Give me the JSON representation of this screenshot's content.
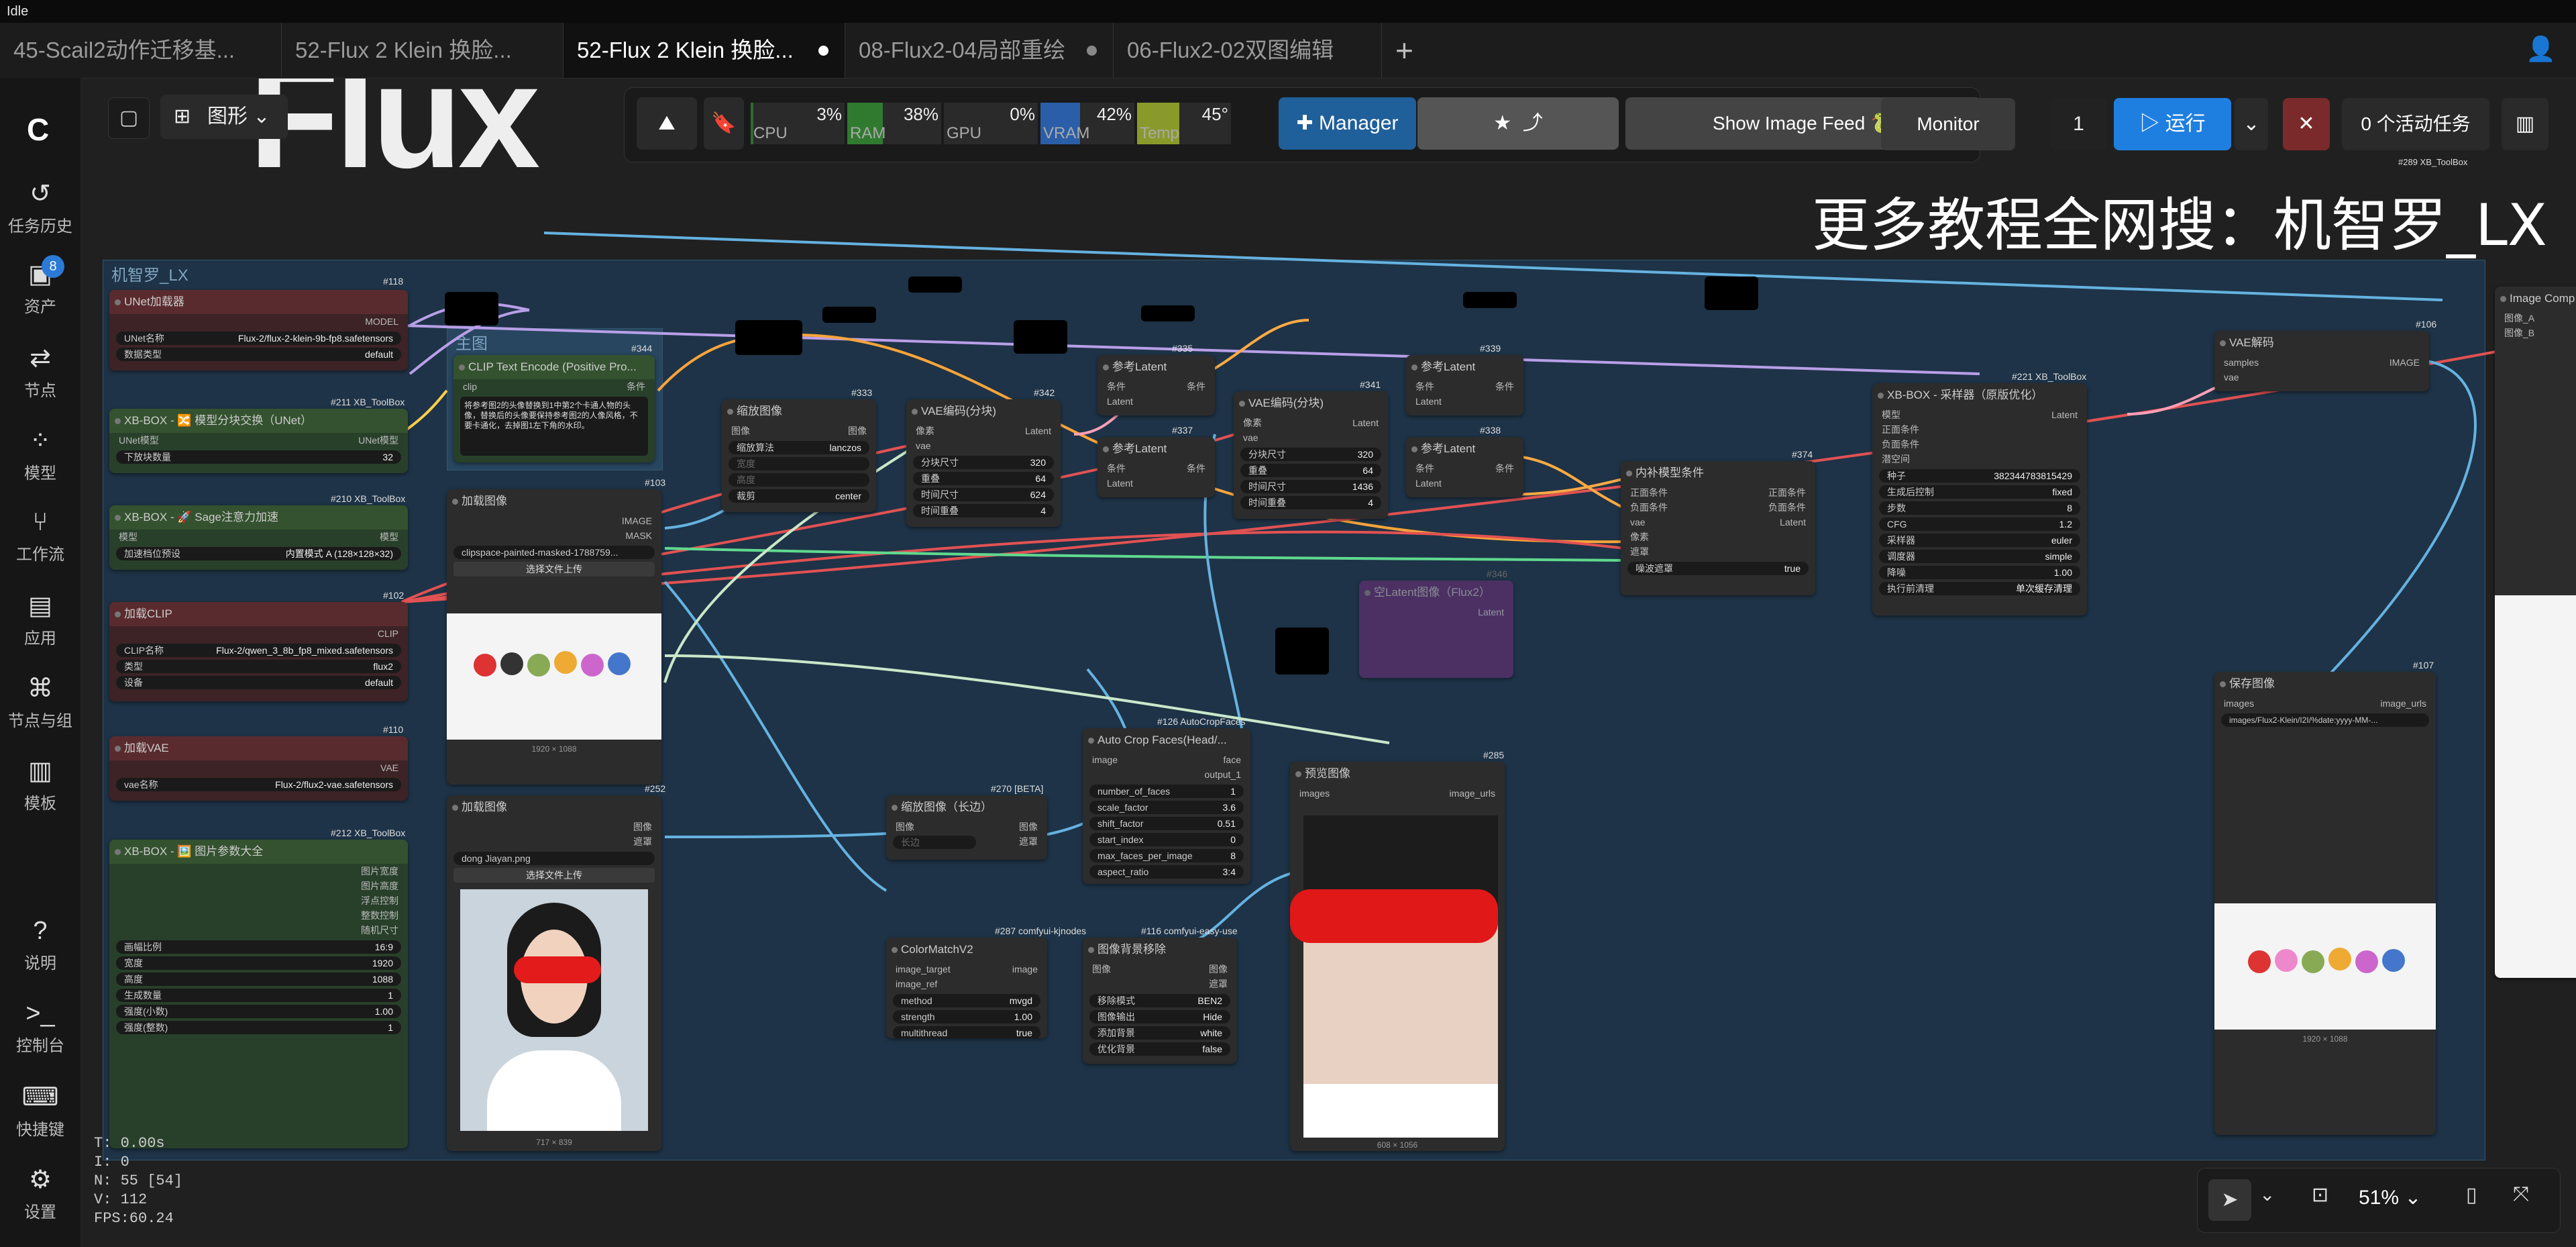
{
  "titlebar": {
    "title": "Idle"
  },
  "tabs": [
    {
      "label": "45-Scail2动作迁移基..."
    },
    {
      "label": "52-Flux 2 Klein 换脸..."
    },
    {
      "label": "52-Flux 2 Klein 换脸..."
    },
    {
      "label": "08-Flux2-04局部重绘"
    },
    {
      "label": "06-Flux2-02双图编辑"
    }
  ],
  "sidebar": {
    "badge_count": "8",
    "items": [
      {
        "label": "任务历史"
      },
      {
        "label": "资产"
      },
      {
        "label": "节点"
      },
      {
        "label": "模型"
      },
      {
        "label": "工作流"
      },
      {
        "label": "应用"
      },
      {
        "label": "节点与组"
      },
      {
        "label": "模板"
      },
      {
        "label": "说明"
      },
      {
        "label": "控制台"
      },
      {
        "label": "快捷键"
      },
      {
        "label": "设置"
      }
    ]
  },
  "canvas_toolbar": {
    "view_mode": "图形"
  },
  "banner": {
    "text": "更多教程全网搜：机智罗_LX",
    "logo_text": "Flux"
  },
  "monitors": [
    {
      "label": "CPU",
      "value": "3%",
      "level": 0.03,
      "color": "#2f6b2f"
    },
    {
      "label": "RAM",
      "value": "38%",
      "level": 0.38,
      "color": "#2f7a2f"
    },
    {
      "label": "GPU",
      "value": "0%",
      "level": 0.0,
      "color": "#2f6b2f"
    },
    {
      "label": "VRAM",
      "value": "42%",
      "level": 0.42,
      "color": "#2b5ea8"
    },
    {
      "label": "Temp",
      "value": "45°",
      "level": 0.45,
      "color": "#8a9a2a"
    }
  ],
  "toolbar": {
    "manager": "Manager",
    "show_image_feed": "Show Image Feed 🐍",
    "monitor": "Monitor",
    "batch_count": "1",
    "run": "运行",
    "active_tasks": "0 个活动任务",
    "toolbox_tag": "#289 XB_ToolBox"
  },
  "group": {
    "title": "机智罗_LX",
    "inner_title": "主图"
  },
  "nodes": {
    "unet": {
      "id": "#118",
      "title": "UNet加载器",
      "out": "MODEL",
      "w1k": "UNet名称",
      "w1v": "Flux-2/flux-2-klein-9b-fp8.safetensors",
      "w2k": "数据类型",
      "w2v": "default"
    },
    "swap": {
      "id": "#211 XB_ToolBox",
      "title": "XB-BOX - 🔀 模型分块交换（UNet）",
      "in": "UNet模型",
      "out": "UNet模型",
      "w1k": "下放块数量",
      "w1v": "32"
    },
    "sage": {
      "id": "#210 XB_ToolBox",
      "title": "XB-BOX - 🚀 Sage注意力加速",
      "in": "模型",
      "out": "模型",
      "w1k": "加速档位预设",
      "w1v": "内置模式 A (128×128×32)"
    },
    "clip": {
      "id": "#102",
      "title": "加载CLIP",
      "out": "CLIP",
      "w1k": "CLIP名称",
      "w1v": "Flux-2/qwen_3_8b_fp8_mixed.safetensors",
      "w2k": "类型",
      "w2v": "flux2",
      "w3k": "设备",
      "w3v": "default"
    },
    "vae": {
      "id": "#110",
      "title": "加载VAE",
      "out": "VAE",
      "w1k": "vae名称",
      "w1v": "Flux-2/flux2-vae.safetensors"
    },
    "params": {
      "id": "#212 XB_ToolBox",
      "title": "XB-BOX - 🖼️ 图片参数大全",
      "outs": [
        "图片宽度",
        "图片高度",
        "浮点控制",
        "整数控制",
        "随机尺寸"
      ],
      "rows": [
        [
          "画幅比例",
          "16:9"
        ],
        [
          "宽度",
          "1920"
        ],
        [
          "高度",
          "1088"
        ],
        [
          "生成数量",
          "1"
        ],
        [
          "强度(小数)",
          "1.00"
        ],
        [
          "强度(整数)",
          "1"
        ]
      ]
    },
    "clip_text": {
      "id": "#344",
      "title": "CLIP Text Encode (Positive Pro...",
      "in": "clip",
      "out": "条件",
      "text": "将参考图2的头像替换到1中第2个卡通人物的头像，替换后的头像要保持参考图2的人像风格，不要卡通化，去掉图1左下角的水印。"
    },
    "load1": {
      "id": "#103",
      "title": "加载图像",
      "outs": [
        "IMAGE",
        "MASK"
      ],
      "file": "clipspace-painted-masked-1788759...",
      "upload": "选择文件上传",
      "caption": "1920 × 1088"
    },
    "load2": {
      "id": "#252",
      "title": "加载图像",
      "outs": [
        "图像",
        "遮罩"
      ],
      "file": "dong Jiayan.png",
      "upload": "选择文件上传",
      "caption": "717 × 839"
    },
    "scale": {
      "id": "#333",
      "title": "缩放图像",
      "in": "图像",
      "out": "图像",
      "rows": [
        [
          "缩放算法",
          "lanczos"
        ],
        [
          "宽度",
          ""
        ],
        [
          "高度",
          ""
        ],
        [
          "裁剪",
          "center"
        ]
      ]
    },
    "vaeenc1": {
      "id": "#342",
      "title": "VAE编码(分块)",
      "ins": [
        "像素",
        "vae"
      ],
      "out": "Latent",
      "rows": [
        [
          "分块尺寸",
          "320"
        ],
        [
          "重叠",
          "64"
        ],
        [
          "时间尺寸",
          "624"
        ],
        [
          "时间重叠",
          "4"
        ]
      ]
    },
    "ref1": {
      "id": "#335",
      "title": "参考Latent",
      "ins": [
        "条件",
        "Latent"
      ],
      "out": "条件"
    },
    "ref2": {
      "id": "#337",
      "title": "参考Latent",
      "ins": [
        "条件",
        "Latent"
      ],
      "out": "条件"
    },
    "vaeenc2": {
      "id": "#341",
      "title": "VAE编码(分块)",
      "ins": [
        "像素",
        "vae"
      ],
      "out": "Latent",
      "rows": [
        [
          "分块尺寸",
          "320"
        ],
        [
          "重叠",
          "64"
        ],
        [
          "时间尺寸",
          "1436"
        ],
        [
          "时间重叠",
          "4"
        ]
      ]
    },
    "ref3": {
      "id": "#339",
      "title": "参考Latent",
      "ins": [
        "条件",
        "Latent"
      ],
      "out": "条件"
    },
    "ref4": {
      "id": "#338",
      "title": "参考Latent",
      "ins": [
        "条件",
        "Latent"
      ],
      "out": "条件"
    },
    "inpaint": {
      "id": "#374",
      "title": "内补模型条件",
      "ins": [
        "正面条件",
        "负面条件",
        "vae",
        "像素",
        "遮罩"
      ],
      "outs": [
        "正面条件",
        "负面条件",
        "Latent"
      ],
      "toggle_k": "噪波遮罩",
      "toggle_v": "true"
    },
    "sampler": {
      "id": "#221 XB_ToolBox",
      "title": "XB-BOX - 采样器（原版优化）",
      "ins": [
        "模型",
        "正面条件",
        "负面条件",
        "潜空间"
      ],
      "out": "Latent",
      "rows": [
        [
          "种子",
          "382344783815429"
        ],
        [
          "生成后控制",
          "fixed"
        ],
        [
          "步数",
          "8"
        ],
        [
          "CFG",
          "1.2"
        ],
        [
          "采样器",
          "euler"
        ],
        [
          "调度器",
          "simple"
        ],
        [
          "降噪",
          "1.00"
        ],
        [
          "执行前清理",
          "单次缓存清理"
        ]
      ]
    },
    "vaedecode": {
      "id": "#106",
      "title": "VAE解码",
      "ins": [
        "samples",
        "vae"
      ],
      "out": "IMAGE"
    },
    "emptylatent": {
      "id": "#346",
      "title": "空Latent图像（Flux2）",
      "out": "Latent"
    },
    "crop": {
      "id": "#126 AutoCropFaces",
      "title": "Auto Crop Faces(Head/...",
      "in": "image",
      "outs": [
        "face",
        "output_1"
      ],
      "rows": [
        [
          "number_of_faces",
          "1"
        ],
        [
          "scale_factor",
          "3.6"
        ],
        [
          "shift_factor",
          "0.51"
        ],
        [
          "start_index",
          "0"
        ],
        [
          "max_faces_per_image",
          "8"
        ],
        [
          "aspect_ratio",
          "3:4"
        ]
      ]
    },
    "scale_long": {
      "id": "#270 [BETA]",
      "title": "缩放图像（长边）",
      "in": "图像",
      "outs": [
        "图像",
        "遮罩"
      ],
      "row": "长边"
    },
    "colormatch": {
      "id": "#287 comfyui-kjnodes",
      "title": "ColorMatchV2",
      "ins": [
        "image_target",
        "image_ref"
      ],
      "out": "image",
      "rows": [
        [
          "method",
          "mvgd"
        ],
        [
          "strength",
          "1.00"
        ],
        [
          "multithread",
          "true"
        ]
      ]
    },
    "rembg": {
      "id": "#116 comfyui-easy-use",
      "title": "图像背景移除",
      "in": "图像",
      "outs": [
        "图像",
        "遮罩"
      ],
      "rows": [
        [
          "移除模式",
          "BEN2"
        ],
        [
          "图像输出",
          "Hide"
        ],
        [
          "添加背景",
          "white"
        ],
        [
          "优化背景",
          "false"
        ]
      ]
    },
    "preview": {
      "id": "#285",
      "title": "预览图像",
      "in": "images",
      "out": "image_urls",
      "caption": "608 × 1056"
    },
    "save": {
      "id": "#107",
      "title": "保存图像",
      "in": "images",
      "out": "image_urls",
      "path": "images/Flux2-Klein/I2I/%date:yyyy-MM-...",
      "caption": "1920 × 1088"
    },
    "compare": {
      "title": "Image Comp",
      "ins": [
        "图像_A",
        "图像_B"
      ]
    }
  },
  "stats": [
    "T: 0.00s",
    "I: 0",
    "N: 55 [54]",
    "V: 112",
    "FPS:60.24"
  ],
  "zoom": {
    "value": "51%"
  }
}
